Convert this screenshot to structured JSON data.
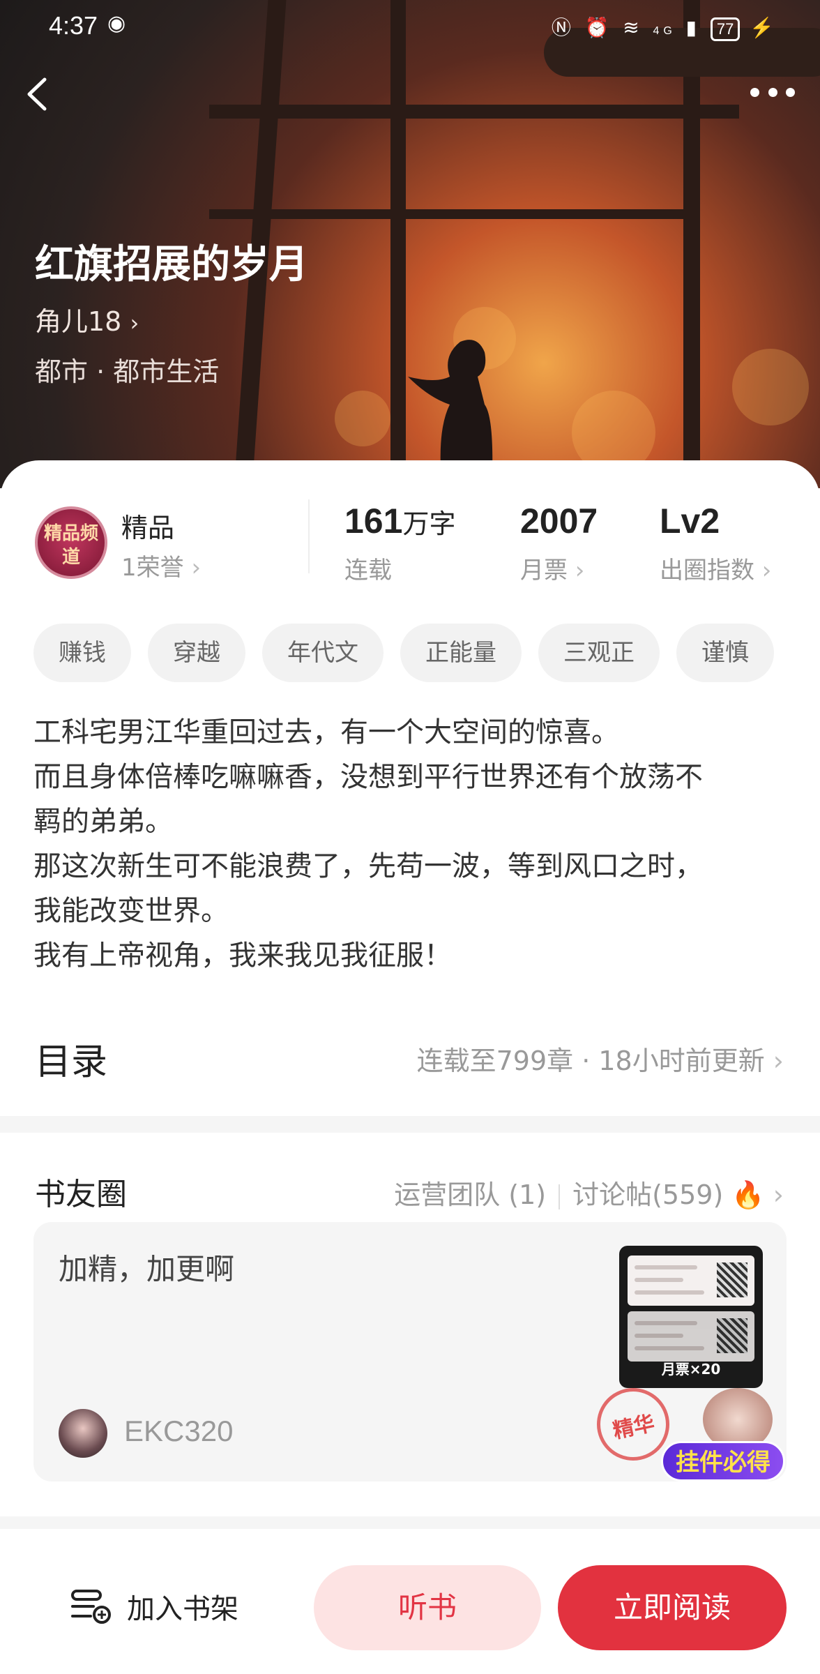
{
  "status_bar": {
    "time": "4:37",
    "network": "4G",
    "battery": "77"
  },
  "book": {
    "title": "红旗招展的岁月",
    "author": "角儿18",
    "genre": "都市 · 都市生活"
  },
  "honor": {
    "badge_text": "精品频道",
    "label": "精品",
    "sub": "1荣誉"
  },
  "stats": [
    {
      "value": "161",
      "unit": "万字",
      "label": "连载"
    },
    {
      "value": "2007",
      "unit": "",
      "label": "月票"
    },
    {
      "value": "Lv2",
      "unit": "",
      "label": "出圈指数"
    }
  ],
  "tags": [
    "赚钱",
    "穿越",
    "年代文",
    "正能量",
    "三观正",
    "谨慎"
  ],
  "synopsis": [
    "工科宅男江华重回过去，有一个大空间的惊喜。",
    "而且身体倍棒吃嘛嘛香，没想到平行世界还有个放荡不",
    "羁的弟弟。",
    "那这次新生可不能浪费了，先苟一波，等到风口之时，",
    "我能改变世界。",
    "我有上帝视角，我来我见我征服！"
  ],
  "toc": {
    "title": "目录",
    "info": "连载至799章 · 18小时前更新"
  },
  "circle": {
    "title": "书友圈",
    "team": "运营团队 (1)",
    "posts_count": "讨论帖(559)",
    "post": {
      "text": "加精，加更啊",
      "user": "EKC320",
      "thumb_caption": "月票×20",
      "stamp": "精华",
      "pendant_badge": "挂件必得"
    }
  },
  "bottom_bar": {
    "shelf": "加入书架",
    "listen": "听书",
    "read": "立即阅读"
  },
  "colors": {
    "accent": "#e2323f",
    "accent_light": "#fde3e3"
  }
}
